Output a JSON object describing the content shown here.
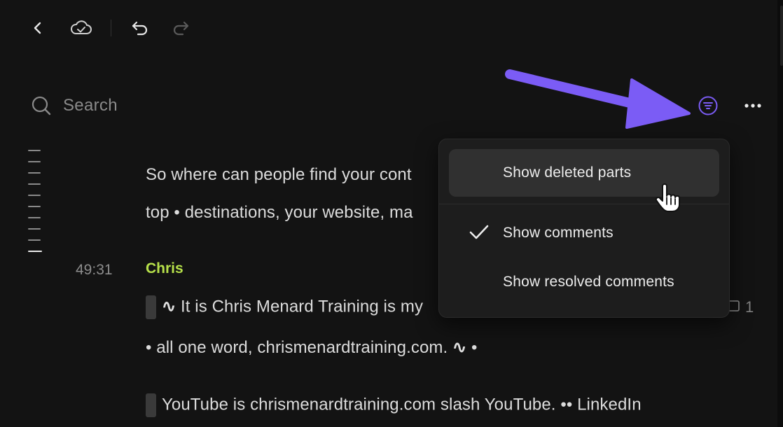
{
  "toolbar": {
    "back_icon": "chevron-left-icon",
    "sync_icon": "cloud-check-icon",
    "undo_icon": "undo-icon",
    "redo_icon": "redo-icon"
  },
  "search": {
    "placeholder": "Search",
    "icon": "search-icon"
  },
  "header_actions": {
    "filter_icon": "filter-icon",
    "more_icon": "more-horizontal-icon"
  },
  "transcript": {
    "lines": [
      {
        "text": "So where can people find your cont"
      },
      {
        "text": "top • destinations, your website, ma"
      }
    ],
    "block": {
      "timestamp": "49:31",
      "speaker": "Chris",
      "line1_rest": " It is Chris Menard Training is my",
      "line2_prefix": "• all one word, chrismenardtraining.com. ",
      "line2_suffix": " •",
      "line3": "YouTube  is chrismenardtraining.com slash YouTube.  •• LinkedIn",
      "wave_glyph": "∿",
      "comment_count": "1"
    }
  },
  "menu": {
    "items": [
      {
        "label": "Show deleted parts",
        "checked": false,
        "hovered": true
      },
      {
        "label": "Show comments",
        "checked": true,
        "hovered": false
      },
      {
        "label": "Show resolved comments",
        "checked": false,
        "hovered": false
      }
    ]
  },
  "colors": {
    "background": "#131313",
    "accent_purple": "#7b5cf5",
    "speaker_green": "#b7e14a",
    "menu_bg": "#1d1d1d"
  }
}
